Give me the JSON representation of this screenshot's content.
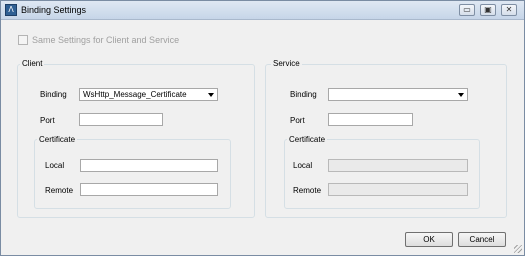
{
  "window": {
    "title": "Binding Settings",
    "icon": "app-icon",
    "controls": {
      "minimize": "▭",
      "maximize": "▣",
      "close": "✕"
    }
  },
  "same_settings": {
    "label": "Same Settings for Client and Service",
    "checked": false,
    "enabled": false
  },
  "client": {
    "group_title": "Client",
    "binding_label": "Binding",
    "binding_value": "WsHttp_Message_Certificate",
    "port_label": "Port",
    "port_value": "",
    "certificate_title": "Certificate",
    "local_label": "Local",
    "local_value": "",
    "remote_label": "Remote",
    "remote_value": ""
  },
  "service": {
    "group_title": "Service",
    "binding_label": "Binding",
    "binding_value": "",
    "port_label": "Port",
    "port_value": "",
    "certificate_title": "Certificate",
    "local_label": "Local",
    "local_value": "",
    "remote_label": "Remote",
    "remote_value": ""
  },
  "buttons": {
    "ok": "OK",
    "cancel": "Cancel"
  }
}
